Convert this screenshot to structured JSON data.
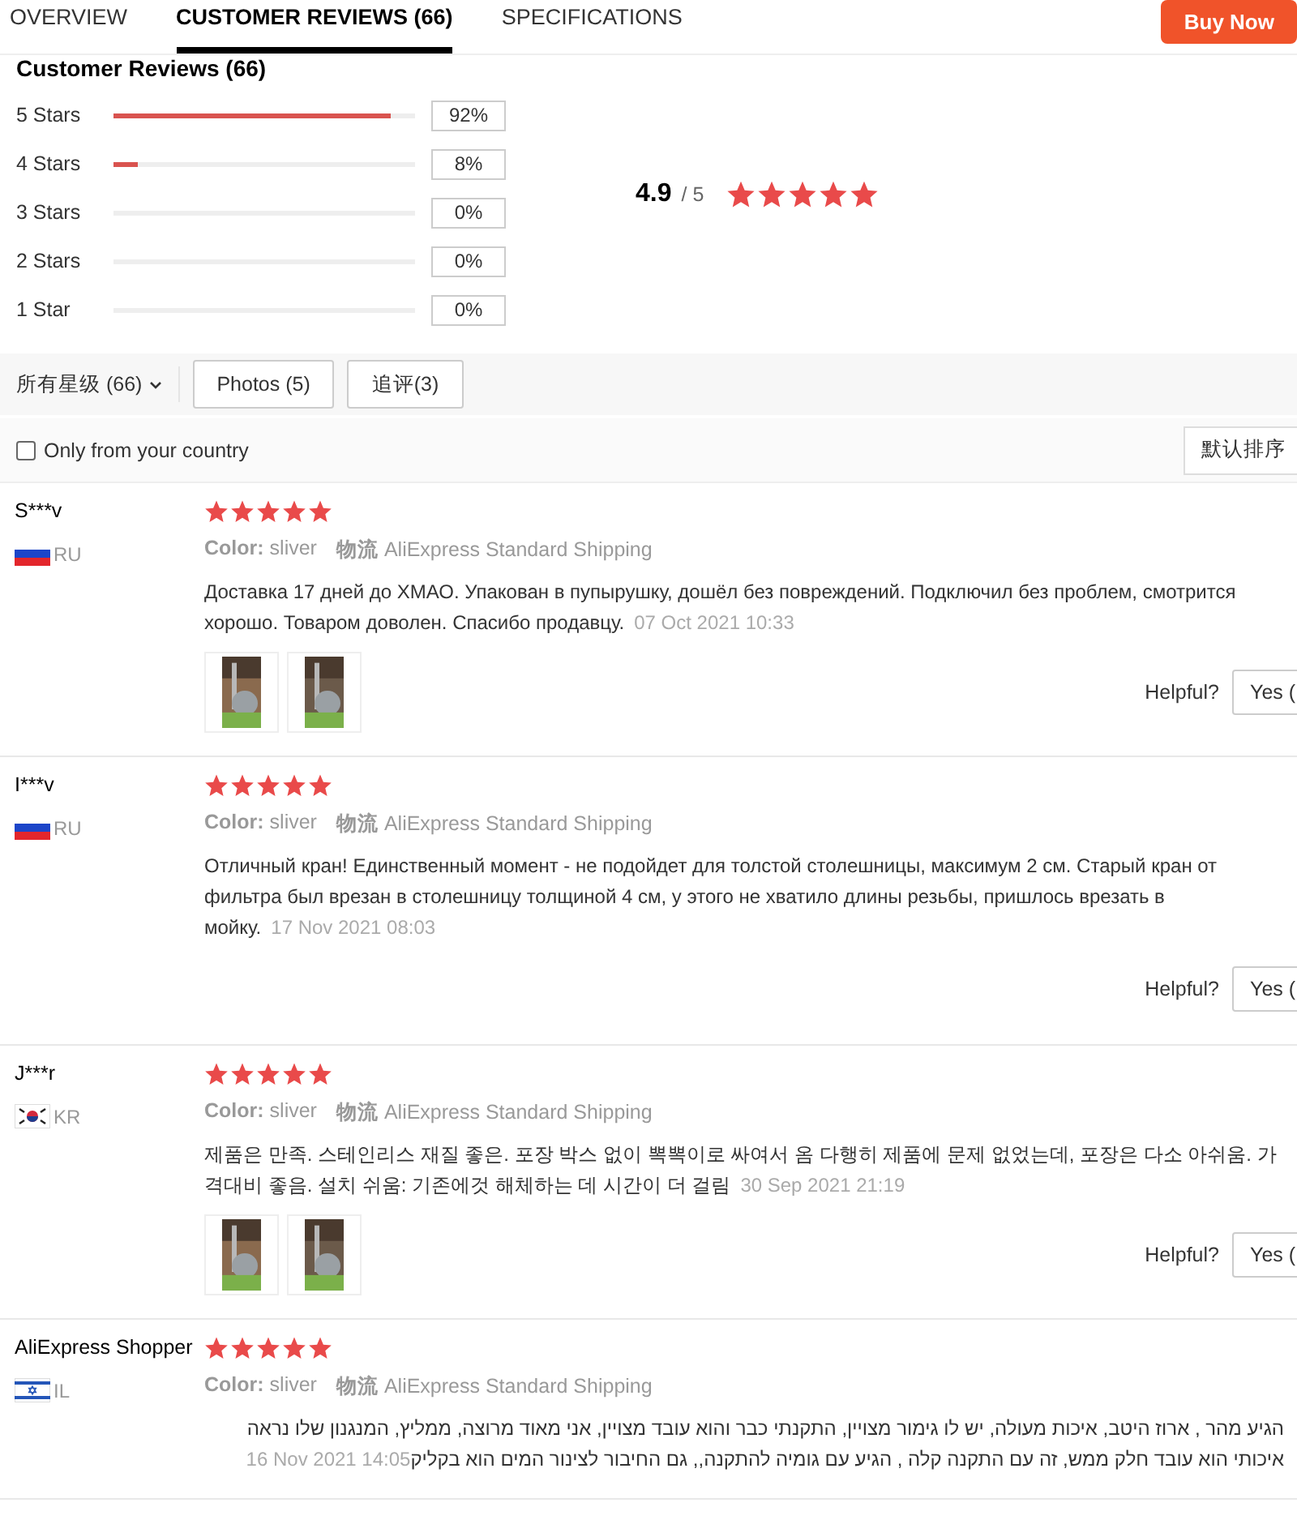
{
  "tabs": [
    {
      "label": "OVERVIEW",
      "selected": false
    },
    {
      "label": "CUSTOMER REVIEWS (66)",
      "selected": true
    },
    {
      "label": "SPECIFICATIONS",
      "selected": false
    }
  ],
  "buy_button": "Buy Now",
  "summary": {
    "title": "Customer Reviews (66)",
    "distribution": [
      {
        "label": "5 Stars",
        "level": 0.92,
        "percent": "92%"
      },
      {
        "label": "4 Stars",
        "level": 0.08,
        "percent": "8%"
      },
      {
        "label": "3 Stars",
        "percent": "0%"
      },
      {
        "label": "2 Stars",
        "percent": "0%"
      },
      {
        "label": "1 Star",
        "percent": "0%"
      }
    ],
    "average": "4.9",
    "out_of": "/ 5",
    "stars": 5
  },
  "filters": {
    "rating_dropdown": "所有星级 (66)",
    "buttons": [
      "Photos (5)",
      "追评(3)"
    ]
  },
  "country_filter": {
    "label": "Only from your country",
    "checked": false
  },
  "sort": "默认排序",
  "reviews": [
    {
      "name": "S***v",
      "flag": {
        "kind": "ru"
      },
      "country": "RU",
      "stars": 5,
      "color_label": "Color:",
      "color_value": "sliver",
      "shipping_label": "物流",
      "shipping": "AliExpress Standard Shipping",
      "kind": "ltr",
      "text": "Доставка 17 дней до ХМАО. Упакован в пупырушку, дошёл без повреждений. Подключил без проблем, смотрится хорошо. Товаром доволен. Спасибо продавцу.",
      "date": "07 Oct 2021 10:33",
      "photos": [
        {
          "kind": "picture"
        },
        {
          "kind": "picture"
        }
      ],
      "helpful_label": "Helpful?",
      "helpful_button": "Yes ("
    },
    {
      "name": "I***v",
      "flag": {
        "kind": "ru"
      },
      "country": "RU",
      "stars": 5,
      "color_label": "Color:",
      "color_value": "sliver",
      "shipping_label": "物流",
      "shipping": "AliExpress Standard Shipping",
      "kind": "ltr",
      "text": "Отличный кран! Единственный момент - не подойдет для толстой столешницы, максимум 2 см. Старый кран от фильтра был врезан в столешницу толщиной 4 см, у этого не хватило длины резьбы, пришлось врезать в мойку.",
      "date": "17 Nov 2021 08:03",
      "helpful_label": "Helpful?",
      "helpful_button": "Yes ("
    },
    {
      "name": "J***r",
      "flag": {
        "kind": "kr"
      },
      "country": "KR",
      "stars": 5,
      "color_label": "Color:",
      "color_value": "sliver",
      "shipping_label": "物流",
      "shipping": "AliExpress Standard Shipping",
      "kind": "ltr",
      "text": "제품은 만족. 스테인리스 재질 좋은. 포장 박스 없이 뽁뽁이로 싸여서 옴 다행히 제품에 문제 없었는데, 포장은 다소 아쉬움. 가격대비 좋음. 설치 쉬움: 기존에것 해체하는 데 시간이 더 걸림",
      "date": "30 Sep 2021 21:19",
      "photos": [
        {
          "kind": "picture"
        },
        {
          "kind": "picture"
        }
      ],
      "helpful_label": "Helpful?",
      "helpful_button": "Yes ("
    },
    {
      "name": "AliExpress Shopper",
      "flag": {
        "kind": "il"
      },
      "country": "IL",
      "stars": 5,
      "color_label": "Color:",
      "color_value": "sliver",
      "shipping_label": "物流",
      "shipping": "AliExpress Standard Shipping",
      "kind": "rtl",
      "text": "הגיע מהר , ארוז היטב, איכות מעולה, יש לו גימור מצויין, התקנתי כבר והוא עובד מצויין, אני מאוד מרוצה, ממליץ, המנגנון שלו נראה איכותי הוא עובד חלק ממש, זה עם התקנה קלה , הגיע עם גומיה להתקנה,, גם החיבור לצינור המים הוא בקליק",
      "date": "16 Nov 2021 14:05"
    }
  ]
}
